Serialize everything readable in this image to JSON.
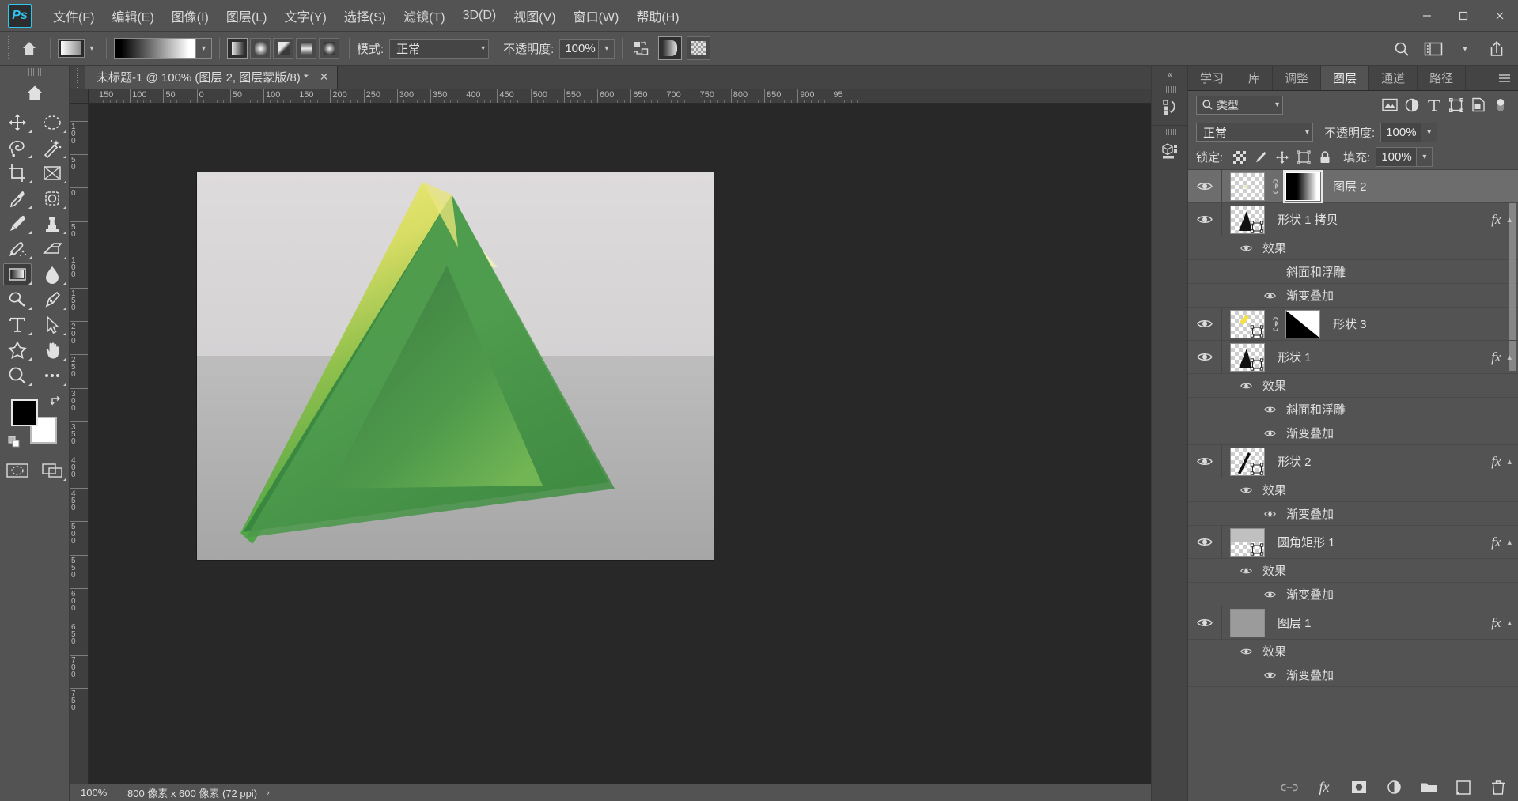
{
  "app": {
    "name": "Photoshop",
    "logo_text": "Ps"
  },
  "menubar": {
    "items": [
      {
        "label": "文件(F)"
      },
      {
        "label": "编辑(E)"
      },
      {
        "label": "图像(I)"
      },
      {
        "label": "图层(L)"
      },
      {
        "label": "文字(Y)"
      },
      {
        "label": "选择(S)"
      },
      {
        "label": "滤镜(T)"
      },
      {
        "label": "3D(D)"
      },
      {
        "label": "视图(V)"
      },
      {
        "label": "窗口(W)"
      },
      {
        "label": "帮助(H)"
      }
    ],
    "window_controls": {
      "minimize": "—",
      "maximize": "❐",
      "close": "✕"
    }
  },
  "optionsbar": {
    "home_icon": "home-icon",
    "gradient_swatch": "gradient-swatch",
    "gradient_preview": "gradient-preview",
    "gradient_types": [
      {
        "name": "linear-gradient",
        "active": true
      },
      {
        "name": "radial-gradient",
        "active": false
      },
      {
        "name": "angle-gradient",
        "active": false
      },
      {
        "name": "reflected-gradient",
        "active": false
      },
      {
        "name": "diamond-gradient",
        "active": false
      }
    ],
    "mode_label": "模式:",
    "mode_value": "正常",
    "opacity_label": "不透明度:",
    "opacity_value": "100%",
    "reverse_icon": "reverse-gradient-icon",
    "dither_icon": "dither-icon",
    "transparency_icon": "transparency-icon",
    "right_icons": [
      "search-icon",
      "workspace-icon",
      "chevron-down-icon",
      "share-icon"
    ]
  },
  "toolbar": {
    "home_icon": "home-icon",
    "tools": [
      {
        "name": "move-tool",
        "glyph": "move",
        "selected": false
      },
      {
        "name": "marquee-tool",
        "glyph": "ellipse-marquee",
        "selected": false
      },
      {
        "name": "lasso-tool",
        "glyph": "lasso",
        "selected": false
      },
      {
        "name": "magic-wand-tool",
        "glyph": "wand",
        "selected": false
      },
      {
        "name": "crop-tool",
        "glyph": "crop",
        "selected": false
      },
      {
        "name": "frame-tool",
        "glyph": "frame",
        "selected": false
      },
      {
        "name": "eyedropper-tool",
        "glyph": "eyedropper",
        "selected": false
      },
      {
        "name": "healing-brush-tool",
        "glyph": "healing",
        "selected": false
      },
      {
        "name": "brush-tool",
        "glyph": "brush",
        "selected": false
      },
      {
        "name": "clone-stamp-tool",
        "glyph": "stamp",
        "selected": false
      },
      {
        "name": "history-brush-tool",
        "glyph": "history-brush",
        "selected": false
      },
      {
        "name": "eraser-tool",
        "glyph": "eraser",
        "selected": false
      },
      {
        "name": "gradient-tool",
        "glyph": "gradient",
        "selected": true
      },
      {
        "name": "blur-tool",
        "glyph": "blur-drop",
        "selected": false
      },
      {
        "name": "dodge-tool",
        "glyph": "dodge",
        "selected": false
      },
      {
        "name": "pen-tool",
        "glyph": "pen",
        "selected": false
      },
      {
        "name": "type-tool",
        "glyph": "type",
        "selected": false
      },
      {
        "name": "path-selection-tool",
        "glyph": "arrow",
        "selected": false
      },
      {
        "name": "shape-tool",
        "glyph": "custom-shape",
        "selected": false
      },
      {
        "name": "hand-tool",
        "glyph": "hand",
        "selected": false
      },
      {
        "name": "zoom-tool",
        "glyph": "zoom",
        "selected": false
      },
      {
        "name": "more-tools",
        "glyph": "ellipsis",
        "selected": false
      }
    ],
    "foreground_color": "#000000",
    "background_color": "#ffffff",
    "swap_icon": "swap-colors-icon",
    "default_icon": "default-colors-icon",
    "quickmask_icon": "quick-mask-icon",
    "screenmode_icon": "screen-mode-icon"
  },
  "document": {
    "tab_title": "未标题-1 @ 100% (图层 2, 图层蒙版/8) *",
    "close_icon": "close-icon",
    "ruler_unit": "px",
    "ruler_h_labels": [
      "150",
      "100",
      "50",
      "0",
      "50",
      "100",
      "150",
      "200",
      "250",
      "300",
      "350",
      "400",
      "450",
      "500",
      "550",
      "600",
      "650",
      "700",
      "750",
      "800",
      "850",
      "900",
      "95"
    ],
    "ruler_v_labels": [
      "100",
      "50",
      "0",
      "50",
      "100",
      "150",
      "200",
      "250",
      "300",
      "350",
      "400",
      "450",
      "500",
      "550",
      "600",
      "650",
      "700",
      "750"
    ],
    "statusbar": {
      "zoom": "100%",
      "dimensions": "800 像素 x 600 像素 (72 ppi)",
      "arrow": "›"
    }
  },
  "rightdock": {
    "collapse_icon": "collapse-panels-icon",
    "rail_icons": [
      "history-panel-icon",
      "3d-panel-icon"
    ],
    "panel_tabs": [
      {
        "label": "学习",
        "active": false
      },
      {
        "label": "库",
        "active": false
      },
      {
        "label": "调整",
        "active": false
      },
      {
        "label": "图层",
        "active": true
      },
      {
        "label": "通道",
        "active": false
      },
      {
        "label": "路径",
        "active": false
      }
    ],
    "panel_menu_icon": "panel-menu-icon",
    "filter": {
      "search_icon": "search-icon",
      "label": "类型",
      "chevron": "chevron-down-icon",
      "icons": [
        "pixel-filter-icon",
        "adjustment-filter-icon",
        "type-filter-icon",
        "shape-filter-icon",
        "smartobject-filter-icon",
        "filter-toggle-icon"
      ]
    },
    "blend": {
      "value": "正常",
      "opacity_label": "不透明度:",
      "opacity_value": "100%"
    },
    "lock": {
      "label": "锁定:",
      "icons": [
        "lock-transparency-icon",
        "lock-image-icon",
        "lock-position-icon",
        "lock-artboard-icon",
        "lock-all-icon"
      ],
      "fill_label": "填充:",
      "fill_value": "100%"
    },
    "layers": [
      {
        "name": "图层 2",
        "selected": true,
        "visible": true,
        "has_mask": true,
        "mask_active": true,
        "mask_gradient": "black-to-white",
        "thumb": "transparent",
        "has_fx": false,
        "effects": []
      },
      {
        "name": "形状 1 拷贝",
        "selected": false,
        "visible": true,
        "has_mask": false,
        "thumb": "shape-triangle",
        "has_fx": true,
        "effects": [
          {
            "label": "效果",
            "visible": true,
            "level": 1
          },
          {
            "label": "斜面和浮雕",
            "visible": false,
            "level": 2
          },
          {
            "label": "渐变叠加",
            "visible": true,
            "level": 2
          }
        ]
      },
      {
        "name": "形状 3",
        "selected": false,
        "visible": true,
        "has_mask": true,
        "mask_active": false,
        "mask_gradient": "diagonal-black-white",
        "thumb": "shape-yellow",
        "has_fx": false,
        "effects": []
      },
      {
        "name": "形状 1",
        "selected": false,
        "visible": true,
        "has_mask": false,
        "thumb": "shape-triangle",
        "has_fx": true,
        "effects": [
          {
            "label": "效果",
            "visible": true,
            "level": 1
          },
          {
            "label": "斜面和浮雕",
            "visible": true,
            "level": 2
          },
          {
            "label": "渐变叠加",
            "visible": true,
            "level": 2
          }
        ]
      },
      {
        "name": "形状 2",
        "selected": false,
        "visible": true,
        "has_mask": false,
        "thumb": "shape-stroke",
        "has_fx": true,
        "effects": [
          {
            "label": "效果",
            "visible": true,
            "level": 1
          },
          {
            "label": "渐变叠加",
            "visible": true,
            "level": 2
          }
        ]
      },
      {
        "name": "圆角矩形 1",
        "selected": false,
        "visible": true,
        "has_mask": false,
        "thumb": "rounded-rect",
        "has_fx": true,
        "effects": [
          {
            "label": "效果",
            "visible": true,
            "level": 1
          },
          {
            "label": "渐变叠加",
            "visible": true,
            "level": 2
          }
        ]
      },
      {
        "name": "图层 1",
        "selected": false,
        "visible": true,
        "has_mask": false,
        "thumb": "gray-solid",
        "has_fx": true,
        "effects": [
          {
            "label": "效果",
            "visible": true,
            "level": 1
          },
          {
            "label": "渐变叠加",
            "visible": true,
            "level": 2
          }
        ]
      }
    ],
    "bottom_icons": [
      "link-layers-icon",
      "add-fx-icon",
      "add-mask-icon",
      "adjustment-layer-icon",
      "new-group-icon",
      "new-layer-icon",
      "delete-layer-icon"
    ]
  },
  "colors": {
    "chrome": "#535353",
    "panel": "#535353",
    "canvas_bg": "#282828",
    "accent": "#31c5f0",
    "selected_row": "#6d6d6d"
  }
}
